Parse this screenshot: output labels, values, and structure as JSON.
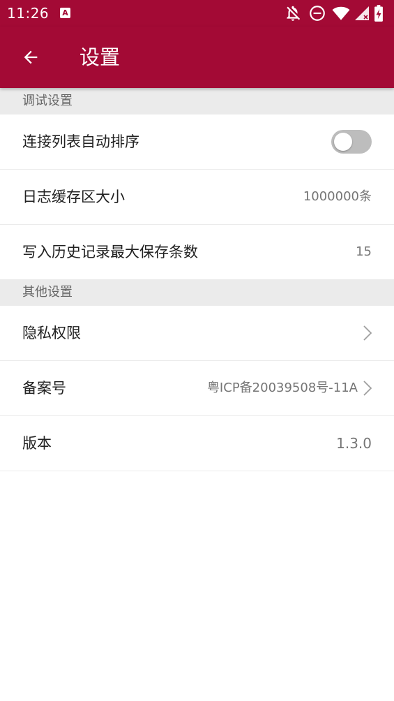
{
  "status_bar": {
    "time": "11:26",
    "notification_icon_letter": "A",
    "icons": [
      "notifications-off-icon",
      "do-not-disturb-icon",
      "wifi-icon",
      "cell-signal-no-data-icon",
      "battery-charging-icon"
    ]
  },
  "toolbar": {
    "title": "设置",
    "back_icon": "arrow-left-icon"
  },
  "colors": {
    "primary": "#a30a35",
    "section_bg": "#ebebeb",
    "value_text": "#757575"
  },
  "sections": [
    {
      "header": "调试设置",
      "rows": [
        {
          "label": "连接列表自动排序",
          "control": "toggle",
          "toggle_on": false
        },
        {
          "label": "日志缓存区大小",
          "value": "1000000条"
        },
        {
          "label": "写入历史记录最大保存条数",
          "value": "15"
        }
      ]
    },
    {
      "header": "其他设置",
      "rows": [
        {
          "label": "隐私权限",
          "control": "chevron"
        },
        {
          "label": "备案号",
          "value": "粤ICP备20039508号-11A",
          "control": "chevron"
        },
        {
          "label": "版本",
          "value": "1.3.0"
        }
      ]
    }
  ]
}
